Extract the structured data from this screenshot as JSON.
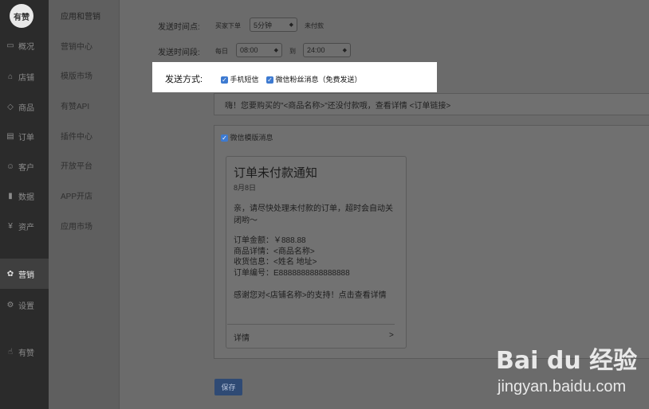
{
  "brand": {
    "logo_text": "有赞"
  },
  "sidebar": {
    "items": [
      {
        "label": "概况",
        "icon": "monitor-icon",
        "glyph": "▭"
      },
      {
        "label": "店铺",
        "icon": "store-icon",
        "glyph": "⌂"
      },
      {
        "label": "商品",
        "icon": "tag-icon",
        "glyph": "◇"
      },
      {
        "label": "订单",
        "icon": "order-icon",
        "glyph": "▤"
      },
      {
        "label": "客户",
        "icon": "user-icon",
        "glyph": "☺"
      },
      {
        "label": "数据",
        "icon": "chart-icon",
        "glyph": "▮"
      },
      {
        "label": "资产",
        "icon": "asset-icon",
        "glyph": "¥"
      },
      {
        "label": "营销",
        "icon": "marketing-icon",
        "glyph": "✿",
        "active": true
      },
      {
        "label": "设置",
        "icon": "gear-icon",
        "glyph": "⚙"
      },
      {
        "label": "有赞",
        "icon": "thumb-icon",
        "glyph": "☝"
      }
    ]
  },
  "submenu": {
    "title": "应用和营销",
    "items": [
      "营销中心",
      "模版市场",
      "有赞API",
      "插件中心",
      "开放平台",
      "APP开店",
      "应用市场"
    ]
  },
  "form": {
    "send_time_label": "发送时间点:",
    "send_time_prefix": "买家下单",
    "send_time_value": "5分钟",
    "send_time_suffix": "未付款",
    "send_period_label": "发送时间段:",
    "period_prefix": "每日",
    "period_start": "08:00",
    "period_to": "到",
    "period_end": "24:00",
    "method_label": "发送方式:",
    "method_sms": "手机短信",
    "method_wechat": "微信粉丝消息（免费发送）",
    "sms_text": "嗨！您要购买的\"<商品名称>\"还没付款哦，查看详情 <订单链接>",
    "template_checkbox": "微信模版消息"
  },
  "card": {
    "title": "订单未付款通知",
    "date": "8月8日",
    "body": "亲，请尽快处理未付款的订单，超时会自动关闭哟～",
    "amount": "订单金额：￥888.88",
    "detail": "商品详情：<商品名称>",
    "receiver": "收货信息：<姓名 地址>",
    "order_no": "订单编号：E8888888888888888",
    "thanks": "感谢您对<店铺名称>的支持！点击查看详情",
    "footer_label": "详情",
    "footer_arrow": ">"
  },
  "save_label": "保存",
  "watermark": {
    "logo": "Bai du 经验",
    "url": "jingyan.baidu.com"
  }
}
